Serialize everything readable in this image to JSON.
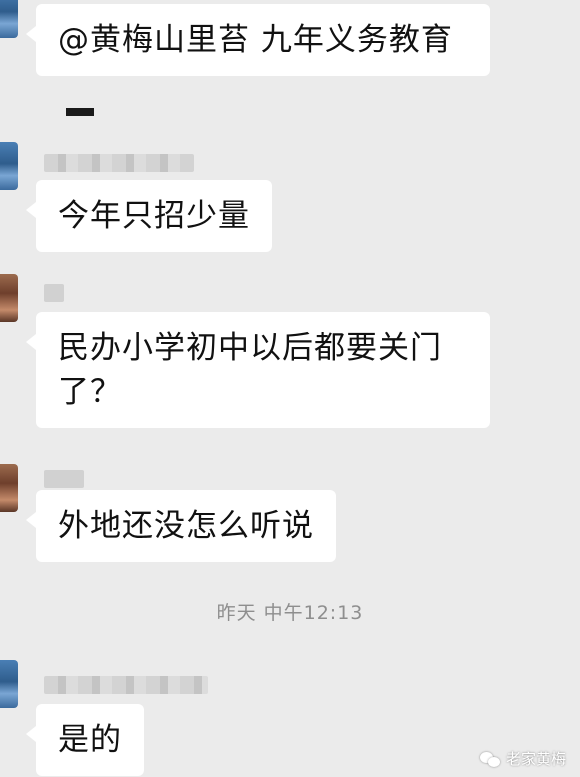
{
  "messages": [
    {
      "text": "@黄梅山里苔  九年义务教育",
      "avatar_color": "#3b6a9c"
    },
    {
      "text": "今年只招少量",
      "avatar_color": "#3b6a9c"
    },
    {
      "text": "民办小学初中以后都要关门了？",
      "avatar_color": "#6e3f2c"
    },
    {
      "text": "外地还没怎么听说",
      "avatar_color": "#6e3f2c"
    },
    {
      "text": "是的",
      "avatar_color": "#3b6a9c"
    }
  ],
  "timestamp": "昨天 中午12:13",
  "watermark": {
    "icon": "wechat-icon",
    "text": "老家黄梅"
  }
}
